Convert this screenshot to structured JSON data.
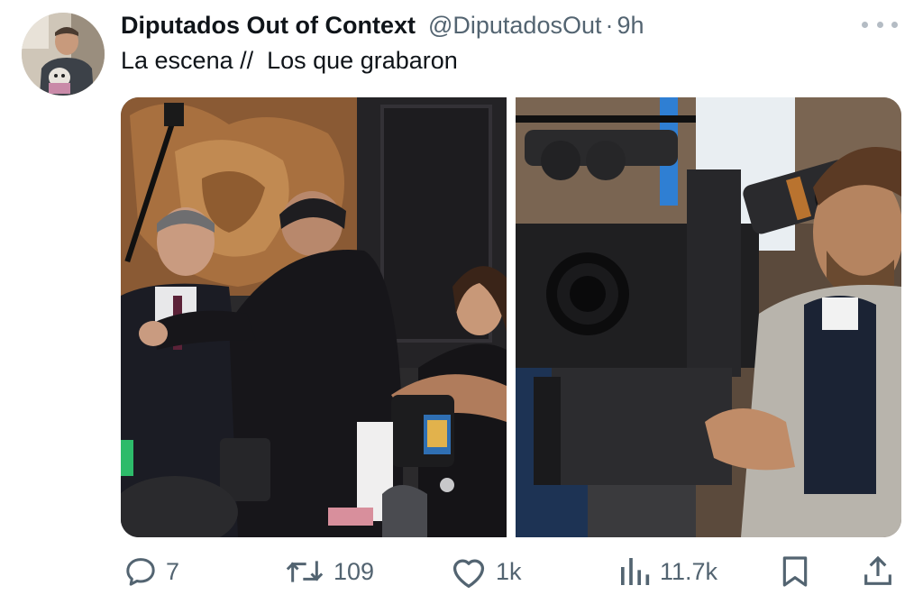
{
  "author": {
    "name": "Diputados Out of Context",
    "handle": "@DiputadosOut",
    "separator": "·",
    "time": "9h"
  },
  "tweet": {
    "text": "La escena //  Los que grabaron"
  },
  "media": {
    "images": [
      {
        "icon": "photo-congress-scene"
      },
      {
        "icon": "photo-cameraman"
      }
    ]
  },
  "actions": {
    "replies": "7",
    "reposts": "109",
    "likes": "1k",
    "views": "11.7k"
  },
  "colors": {
    "text": "#0f1419",
    "muted": "#536471"
  }
}
